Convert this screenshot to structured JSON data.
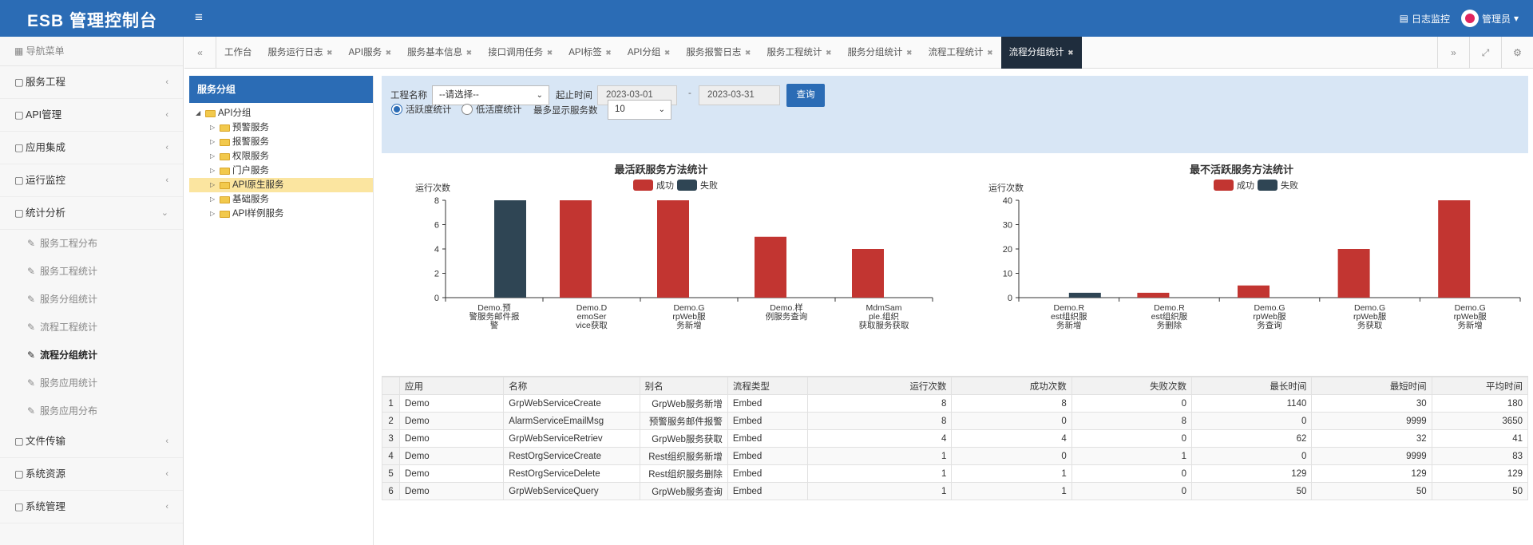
{
  "header": {
    "brand": "ESB 管理控制台",
    "menu_icon": "hamburger-icon",
    "log_monitor": "日志监控",
    "user": "管理员"
  },
  "sidebar": {
    "nav_title": "导航菜单",
    "groups": [
      {
        "label": "服务工程"
      },
      {
        "label": "API管理"
      },
      {
        "label": "应用集成"
      },
      {
        "label": "运行监控"
      },
      {
        "label": "统计分析",
        "expanded": true
      }
    ],
    "sub_items": [
      {
        "label": "服务工程分布"
      },
      {
        "label": "服务工程统计"
      },
      {
        "label": "服务分组统计"
      },
      {
        "label": "流程工程统计"
      },
      {
        "label": "流程分组统计",
        "active": true
      },
      {
        "label": "服务应用统计"
      },
      {
        "label": "服务应用分布"
      }
    ],
    "groups_after": [
      {
        "label": "文件传输"
      },
      {
        "label": "系统资源"
      },
      {
        "label": "系统管理"
      }
    ]
  },
  "tabs": [
    {
      "label": "工作台",
      "closable": false
    },
    {
      "label": "服务运行日志",
      "closable": true
    },
    {
      "label": "API服务",
      "closable": true
    },
    {
      "label": "服务基本信息",
      "closable": true
    },
    {
      "label": "接口调用任务",
      "closable": true
    },
    {
      "label": "API标签",
      "closable": true
    },
    {
      "label": "API分组",
      "closable": true
    },
    {
      "label": "服务报警日志",
      "closable": true
    },
    {
      "label": "服务工程统计",
      "closable": true
    },
    {
      "label": "服务分组统计",
      "closable": true
    },
    {
      "label": "流程工程统计",
      "closable": true
    },
    {
      "label": "流程分组统计",
      "closable": true,
      "active": true
    }
  ],
  "tree": {
    "title": "服务分组",
    "root": "API分组",
    "children": [
      "预警服务",
      "报警服务",
      "权限服务",
      "门户服务",
      "API原生服务",
      "基础服务",
      "API样例服务"
    ],
    "selected": "API原生服务"
  },
  "filter": {
    "project_label": "工程名称",
    "project_value": "--请选择--",
    "time_label": "起止时间",
    "start_date": "2023-03-01",
    "date_sep": "-",
    "end_date": "2023-03-31",
    "query_btn": "查询",
    "radio_active": "活跃度统计",
    "radio_inactive": "低活度统计",
    "max_label": "最多显示服务数",
    "max_value": "10"
  },
  "chart_data": [
    {
      "type": "bar",
      "title": "最活跃服务方法统计",
      "ylabel": "运行次数",
      "legend": [
        "成功",
        "失败"
      ],
      "ylim": [
        0,
        8
      ],
      "yticks": [
        0,
        2,
        4,
        6,
        8
      ],
      "categories": [
        "Demo.预警服务邮件报警",
        "Demo.DemoService获取",
        "Demo.GrpWeb服务新增",
        "Demo.样例服务查询",
        "MdmSample.组织获取服务获取"
      ],
      "category_lines": [
        [
          "Demo.预",
          "警服务邮件报",
          "警"
        ],
        [
          "Demo.D",
          "emoSer",
          "vice获取"
        ],
        [
          "Demo.G",
          "rpWeb服",
          "务新增"
        ],
        [
          "Demo.样",
          "例服务查询"
        ],
        [
          "MdmSam",
          "ple.组织",
          "获取服务获取"
        ]
      ],
      "series": [
        {
          "name": "成功",
          "color": "#c23531",
          "values": [
            0,
            8,
            8,
            5,
            4
          ]
        },
        {
          "name": "失败",
          "color": "#2f4554",
          "values": [
            8,
            0,
            0,
            0,
            0
          ]
        }
      ]
    },
    {
      "type": "bar",
      "title": "最不活跃服务方法统计",
      "ylabel": "运行次数",
      "legend": [
        "成功",
        "失败"
      ],
      "ylim": [
        0,
        40
      ],
      "yticks": [
        0,
        10,
        20,
        30,
        40
      ],
      "categories": [
        "Demo.Rest组织服务新增",
        "Demo.Rest组织服务删除",
        "Demo.GrpWeb服务查询",
        "Demo.GrpWeb服务获取",
        "Demo.GrpWeb服务新增"
      ],
      "category_lines": [
        [
          "Demo.R",
          "est组织服",
          "务新增"
        ],
        [
          "Demo.R",
          "est组织服",
          "务删除"
        ],
        [
          "Demo.G",
          "rpWeb服",
          "务查询"
        ],
        [
          "Demo.G",
          "rpWeb服",
          "务获取"
        ],
        [
          "Demo.G",
          "rpWeb服",
          "务新增"
        ]
      ],
      "series": [
        {
          "name": "成功",
          "color": "#c23531",
          "values": [
            0,
            2,
            5,
            20,
            40
          ]
        },
        {
          "name": "失败",
          "color": "#2f4554",
          "values": [
            2,
            0,
            0,
            0,
            0
          ]
        }
      ]
    }
  ],
  "table": {
    "columns": [
      "应用",
      "名称",
      "别名",
      "流程类型",
      "运行次数",
      "成功次数",
      "失败次数",
      "最长时间",
      "最短时间",
      "平均时间"
    ],
    "rows": [
      [
        "1",
        "Demo",
        "GrpWebServiceCreate",
        "GrpWeb服务新增",
        "Embed",
        "8",
        "8",
        "0",
        "1140",
        "30",
        "180"
      ],
      [
        "2",
        "Demo",
        "AlarmServiceEmailMsg",
        "预警服务邮件报警",
        "Embed",
        "8",
        "0",
        "8",
        "0",
        "9999",
        "3650"
      ],
      [
        "3",
        "Demo",
        "GrpWebServiceRetriev",
        "GrpWeb服务获取",
        "Embed",
        "4",
        "4",
        "0",
        "62",
        "32",
        "41"
      ],
      [
        "4",
        "Demo",
        "RestOrgServiceCreate",
        "Rest组织服务新增",
        "Embed",
        "1",
        "0",
        "1",
        "0",
        "9999",
        "83"
      ],
      [
        "5",
        "Demo",
        "RestOrgServiceDelete",
        "Rest组织服务删除",
        "Embed",
        "1",
        "1",
        "0",
        "129",
        "129",
        "129"
      ],
      [
        "6",
        "Demo",
        "GrpWebServiceQuery",
        "GrpWeb服务查询",
        "Embed",
        "1",
        "1",
        "0",
        "50",
        "50",
        "50"
      ]
    ]
  }
}
